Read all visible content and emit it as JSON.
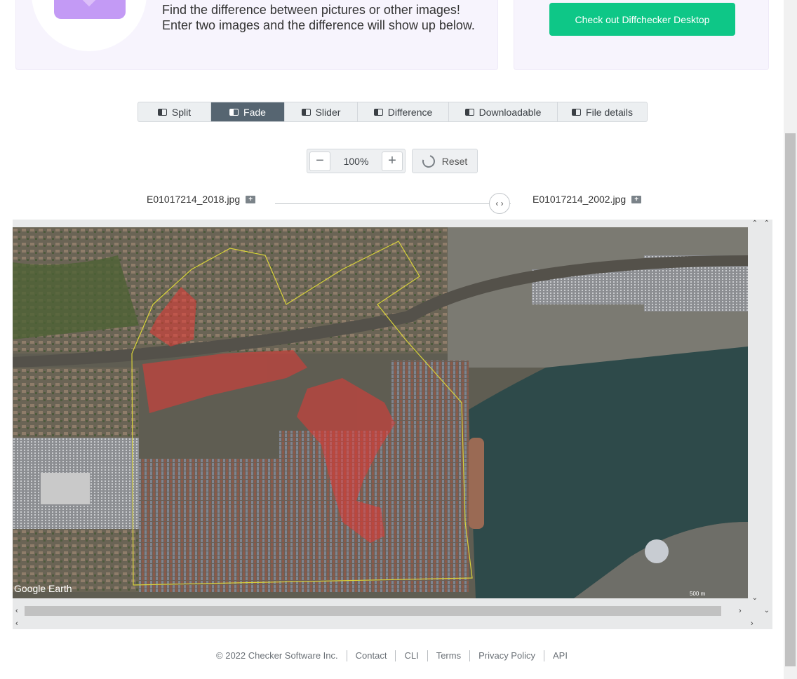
{
  "hero": {
    "line1": "Find the difference between pictures or other images!",
    "line2": "Enter two images and the difference will show up below.",
    "cta_label": "Check out Diffchecker Desktop"
  },
  "tabs": [
    {
      "label": "Split",
      "icon": "split-icon",
      "active": false
    },
    {
      "label": "Fade",
      "icon": "fade-icon",
      "active": true
    },
    {
      "label": "Slider",
      "icon": "slider-icon",
      "active": false
    },
    {
      "label": "Difference",
      "icon": "difference-icon",
      "active": false
    },
    {
      "label": "Downloadable",
      "icon": "download-icon",
      "active": false
    },
    {
      "label": "File details",
      "icon": "file-details-icon",
      "active": false
    }
  ],
  "zoom": {
    "minus": "−",
    "value": "100%",
    "plus": "+",
    "reset_label": "Reset"
  },
  "files": {
    "left_name": "E01017214_2018.jpg",
    "right_name": "E01017214_2002.jpg",
    "slider_glyph": "‹ ›",
    "fade_fraction": 0.9
  },
  "image": {
    "watermark": "Google Earth",
    "scale_label": "500 m"
  },
  "scroll_glyphs": {
    "up": "⌃",
    "down": "⌄",
    "left": "‹",
    "right": "›"
  },
  "footer": {
    "copyright": "© 2022 Checker Software Inc.",
    "links": [
      "Contact",
      "CLI",
      "Terms",
      "Privacy Policy",
      "API"
    ]
  },
  "colors": {
    "accent_green": "#0ec787",
    "active_tab": "#566571",
    "diff_overlay": "#e53935"
  }
}
